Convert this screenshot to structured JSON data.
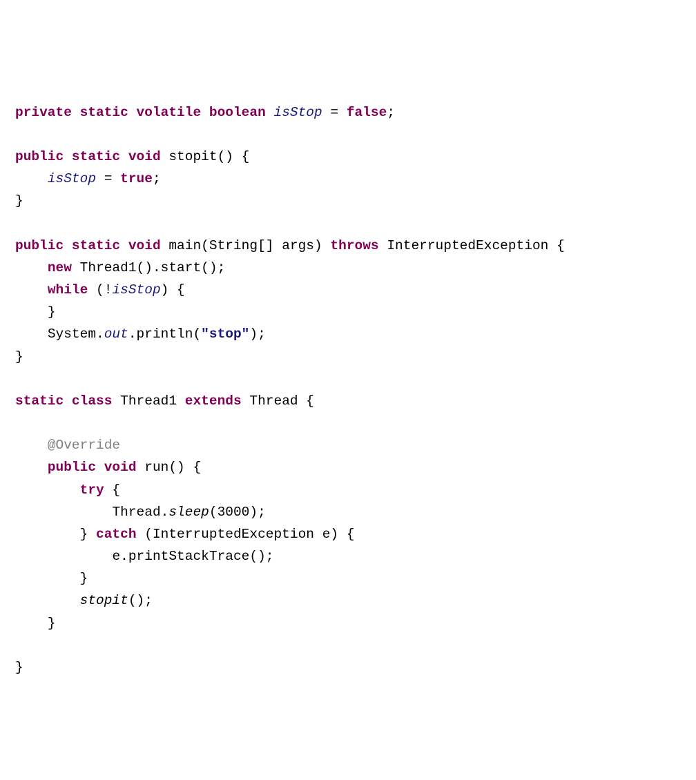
{
  "kw": {
    "private": "private",
    "static": "static",
    "volatile": "volatile",
    "boolean": "boolean",
    "public": "public",
    "void": "void",
    "class": "class",
    "extends": "extends",
    "new": "new",
    "while": "while",
    "try": "try",
    "catch": "catch",
    "throws": "throws",
    "true": "true",
    "false": "false"
  },
  "id": {
    "isStop": "isStop",
    "stopit": "stopit",
    "main": "main",
    "String": "String",
    "args": "args",
    "InterruptedException": "InterruptedException",
    "Thread1": "Thread1",
    "start": "start",
    "System": "System",
    "out": "out",
    "println": "println",
    "Thread": "Thread",
    "Override": "@Override",
    "run": "run",
    "sleep": "sleep",
    "e": "e",
    "printStackTrace": "printStackTrace"
  },
  "lit": {
    "stop": "\"stop\"",
    "threeThousand": "3000"
  },
  "glyph": {
    "brackets": "[]"
  }
}
